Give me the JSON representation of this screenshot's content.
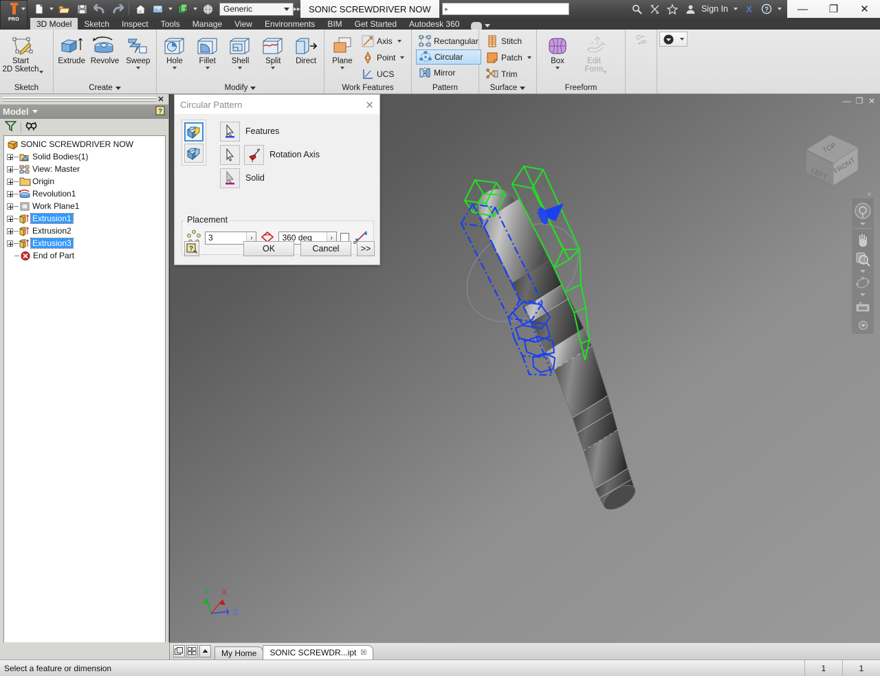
{
  "app": {
    "title": "SONIC SCREWDRIVER NOW",
    "logo_text": "PRO",
    "material": "Generic",
    "sign_in": "Sign In",
    "search_placeholder": ""
  },
  "window_controls": {
    "minimize": "—",
    "restore": "❐",
    "close": "✕"
  },
  "quick_access": [
    {
      "name": "new-icon",
      "label": "New"
    },
    {
      "name": "open-icon",
      "label": "Open"
    },
    {
      "name": "save-icon",
      "label": "Save"
    },
    {
      "name": "undo-icon",
      "label": "Undo"
    },
    {
      "name": "redo-icon",
      "label": "Redo"
    },
    {
      "name": "home-icon",
      "label": "Home"
    },
    {
      "name": "appearance-icon",
      "label": "Appearance"
    },
    {
      "name": "material-icon",
      "label": "Material"
    },
    {
      "name": "sphere-icon",
      "label": "Visual Style"
    }
  ],
  "ribbon": {
    "tabs": [
      {
        "label": "3D Model",
        "active": true
      },
      {
        "label": "Sketch",
        "active": false
      },
      {
        "label": "Inspect",
        "active": false
      },
      {
        "label": "Tools",
        "active": false
      },
      {
        "label": "Manage",
        "active": false
      },
      {
        "label": "View",
        "active": false
      },
      {
        "label": "Environments",
        "active": false
      },
      {
        "label": "BIM",
        "active": false
      },
      {
        "label": "Get Started",
        "active": false
      },
      {
        "label": "Autodesk 360",
        "active": false
      }
    ],
    "panels": [
      {
        "title": "Sketch",
        "has_dropdown": false,
        "big": [
          {
            "label": "Start\n2D Sketch",
            "icon": "sketch-icon",
            "dropdown": true,
            "disabled": false
          }
        ],
        "small": []
      },
      {
        "title": "Create",
        "has_dropdown": true,
        "big": [
          {
            "label": "Extrude",
            "icon": "extrude-icon",
            "dropdown": false,
            "disabled": false
          },
          {
            "label": "Revolve",
            "icon": "revolve-icon",
            "dropdown": false,
            "disabled": false
          },
          {
            "label": "Sweep",
            "icon": "sweep-icon",
            "dropdown": true,
            "disabled": false
          }
        ],
        "small": []
      },
      {
        "title": "Modify",
        "has_dropdown": true,
        "big": [
          {
            "label": "Hole",
            "icon": "hole-icon",
            "dropdown": true,
            "disabled": false
          },
          {
            "label": "Fillet",
            "icon": "fillet-icon",
            "dropdown": true,
            "disabled": false
          },
          {
            "label": "Shell",
            "icon": "shell-icon",
            "dropdown": true,
            "disabled": false
          },
          {
            "label": "Split",
            "icon": "split-icon",
            "dropdown": true,
            "disabled": false
          },
          {
            "label": "Direct",
            "icon": "direct-icon",
            "dropdown": false,
            "disabled": false
          }
        ],
        "small": []
      },
      {
        "title": "Work Features",
        "has_dropdown": false,
        "big": [
          {
            "label": "Plane",
            "icon": "plane-icon",
            "dropdown": true,
            "disabled": false
          }
        ],
        "small": [
          {
            "label": "Axis",
            "icon": "axis-icon",
            "dropdown": true,
            "selected": false
          },
          {
            "label": "Point",
            "icon": "point-icon",
            "dropdown": true,
            "selected": false
          },
          {
            "label": "UCS",
            "icon": "ucs-icon",
            "dropdown": false,
            "selected": false
          }
        ]
      },
      {
        "title": "Pattern",
        "has_dropdown": false,
        "big": [],
        "small": [
          {
            "label": "Rectangular",
            "icon": "rectangular-pattern-icon",
            "dropdown": false,
            "selected": false
          },
          {
            "label": "Circular",
            "icon": "circular-pattern-icon",
            "dropdown": false,
            "selected": true
          },
          {
            "label": "Mirror",
            "icon": "mirror-icon",
            "dropdown": false,
            "selected": false
          }
        ]
      },
      {
        "title": "Surface",
        "has_dropdown": true,
        "big": [],
        "small": [
          {
            "label": "Stitch",
            "icon": "stitch-icon",
            "dropdown": false,
            "selected": false
          },
          {
            "label": "Patch",
            "icon": "patch-icon",
            "dropdown": true,
            "selected": false
          },
          {
            "label": "Trim",
            "icon": "trim-icon",
            "dropdown": false,
            "selected": false
          }
        ]
      },
      {
        "title": "Freeform",
        "has_dropdown": false,
        "big": [
          {
            "label": "Box",
            "icon": "freeform-box-icon",
            "dropdown": true,
            "disabled": false
          },
          {
            "label": "Edit\nForm",
            "icon": "edit-form-icon",
            "dropdown": true,
            "disabled": true
          }
        ],
        "small": []
      },
      {
        "title": "",
        "has_dropdown": false,
        "big": [],
        "small": [
          {
            "label": "",
            "icon": "convert-icon",
            "dropdown": false,
            "selected": false
          },
          {
            "label": "",
            "icon": "panel-dropdown-icon",
            "dropdown": true,
            "selected": false
          }
        ]
      }
    ]
  },
  "browser": {
    "header": "Model",
    "help_icon": "help-icon",
    "filter_icon": "filter-icon",
    "find_icon": "find-icon",
    "close_icon": "close-icon",
    "tree": [
      {
        "label": "SONIC SCREWDRIVER NOW",
        "icon": "part-icon",
        "depth": 0,
        "expander": false,
        "selected": false
      },
      {
        "label": "Solid Bodies(1)",
        "icon": "solid-bodies-icon",
        "depth": 1,
        "expander": true,
        "selected": false
      },
      {
        "label": "View: Master",
        "icon": "view-icon",
        "depth": 1,
        "expander": true,
        "selected": false
      },
      {
        "label": "Origin",
        "icon": "folder-icon",
        "depth": 1,
        "expander": true,
        "selected": false
      },
      {
        "label": "Revolution1",
        "icon": "revolve-icon",
        "depth": 1,
        "expander": true,
        "selected": false
      },
      {
        "label": "Work Plane1",
        "icon": "workplane-icon",
        "depth": 1,
        "expander": true,
        "selected": false
      },
      {
        "label": "Extrusion1",
        "icon": "extrusion-icon",
        "depth": 1,
        "expander": true,
        "selected": true
      },
      {
        "label": "Extrusion2",
        "icon": "extrusion-icon",
        "depth": 1,
        "expander": true,
        "selected": false
      },
      {
        "label": "Extrusion3",
        "icon": "extrusion-icon",
        "depth": 1,
        "expander": true,
        "selected": true
      },
      {
        "label": "End of Part",
        "icon": "end-of-part-icon",
        "depth": 1,
        "expander": false,
        "selected": false
      }
    ]
  },
  "dialog": {
    "title": "Circular Pattern",
    "close_label": "✕",
    "shape_buttons": [
      {
        "name": "optimized-creation-button",
        "active": true
      },
      {
        "name": "identical-creation-button",
        "active": false
      }
    ],
    "selectors": [
      {
        "label": "Features",
        "icon": "arrow-select-features-icon",
        "underline": "#2b4fd6"
      },
      {
        "label": "Rotation Axis",
        "icon": "arrow-select-axis-icon",
        "underline": "none"
      },
      {
        "label": "Solid",
        "icon": "arrow-select-solid-icon",
        "underline": "#b0197a"
      }
    ],
    "axis_button": "rotation-axis-direction-icon",
    "placement": {
      "legend": "Placement",
      "count_icon": "pattern-count-icon",
      "count_value": "3",
      "angle_icon": "pattern-angle-icon",
      "angle_value": "360 deg",
      "midplane_checked": false,
      "midplane_icon": "midplane-icon",
      "spin_arrow": "›"
    },
    "buttons": {
      "help": "?",
      "ok": "OK",
      "cancel": "Cancel",
      "more": ">>"
    }
  },
  "viewport": {
    "viewcube": {
      "top": "TOP",
      "left": "LEFT",
      "front": "FRONT"
    },
    "axis_triad": {
      "x": "X",
      "y": "Y",
      "z": "Z",
      "x_color": "#d42a2a",
      "y_color": "#1faa2e",
      "z_color": "#2b47e0"
    },
    "navbar": [
      {
        "name": "steering-wheel-icon"
      },
      {
        "name": "pan-icon"
      },
      {
        "name": "zoom-icon"
      },
      {
        "name": "orbit-icon"
      },
      {
        "name": "look-at-icon"
      },
      {
        "name": "navbar-options-icon"
      }
    ],
    "doc_controls": {
      "minimize": "—",
      "restore": "❐",
      "close": "✕"
    },
    "colors": {
      "selected_feature": "#22e024",
      "preview": "#1a3ff0",
      "body": "#8d8d8d"
    }
  },
  "bottom": {
    "tab_tools": [
      "tile-icon",
      "grid-icon",
      "up-icon"
    ],
    "doc_tabs": [
      {
        "label": "My Home",
        "active": false,
        "closable": false
      },
      {
        "label": "SONIC SCREWDR...ipt",
        "active": true,
        "closable": true
      }
    ],
    "close_glyph": "☒"
  },
  "status": {
    "message": "Select a feature or dimension",
    "cell1": "1",
    "cell2": "1"
  }
}
